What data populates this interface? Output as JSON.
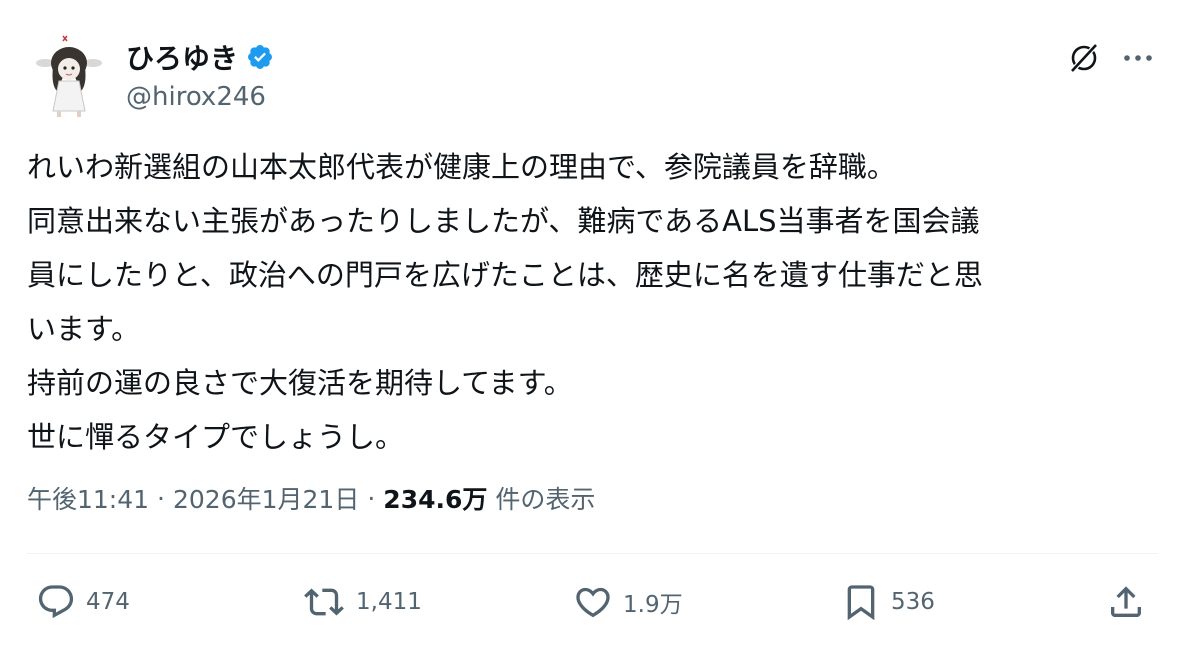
{
  "author": {
    "display_name": "ひろゆき",
    "handle": "@hirox246"
  },
  "tweet": {
    "lines": [
      "れいわ新選組の山本太郎代表が健康上の理由で、参院議員を辞職。",
      "同意出来ない主張があったりしましたが、難病であるALS当事者を国会議",
      "員にしたりと、政治への門戸を広げたことは、歴史に名を遺す仕事だと思",
      "います。",
      "持前の運の良さで大復活を期待してます。",
      "世に憚るタイプでしょうし。"
    ]
  },
  "meta": {
    "time": "午後11:41",
    "date": "2026年1月21日",
    "views_count": "234.6万",
    "views_label": "件の表示"
  },
  "actions": {
    "replies": "474",
    "reposts": "1,411",
    "likes": "1.9万",
    "bookmarks": "536"
  },
  "colors": {
    "text": "#0f1419",
    "secondary": "#536471",
    "verified": "#1d9bf0",
    "divider": "#eff3f4"
  },
  "icons": [
    "verified-badge-icon",
    "grok-icon",
    "more-icon",
    "reply-icon",
    "repost-icon",
    "like-icon",
    "bookmark-icon",
    "share-icon"
  ]
}
